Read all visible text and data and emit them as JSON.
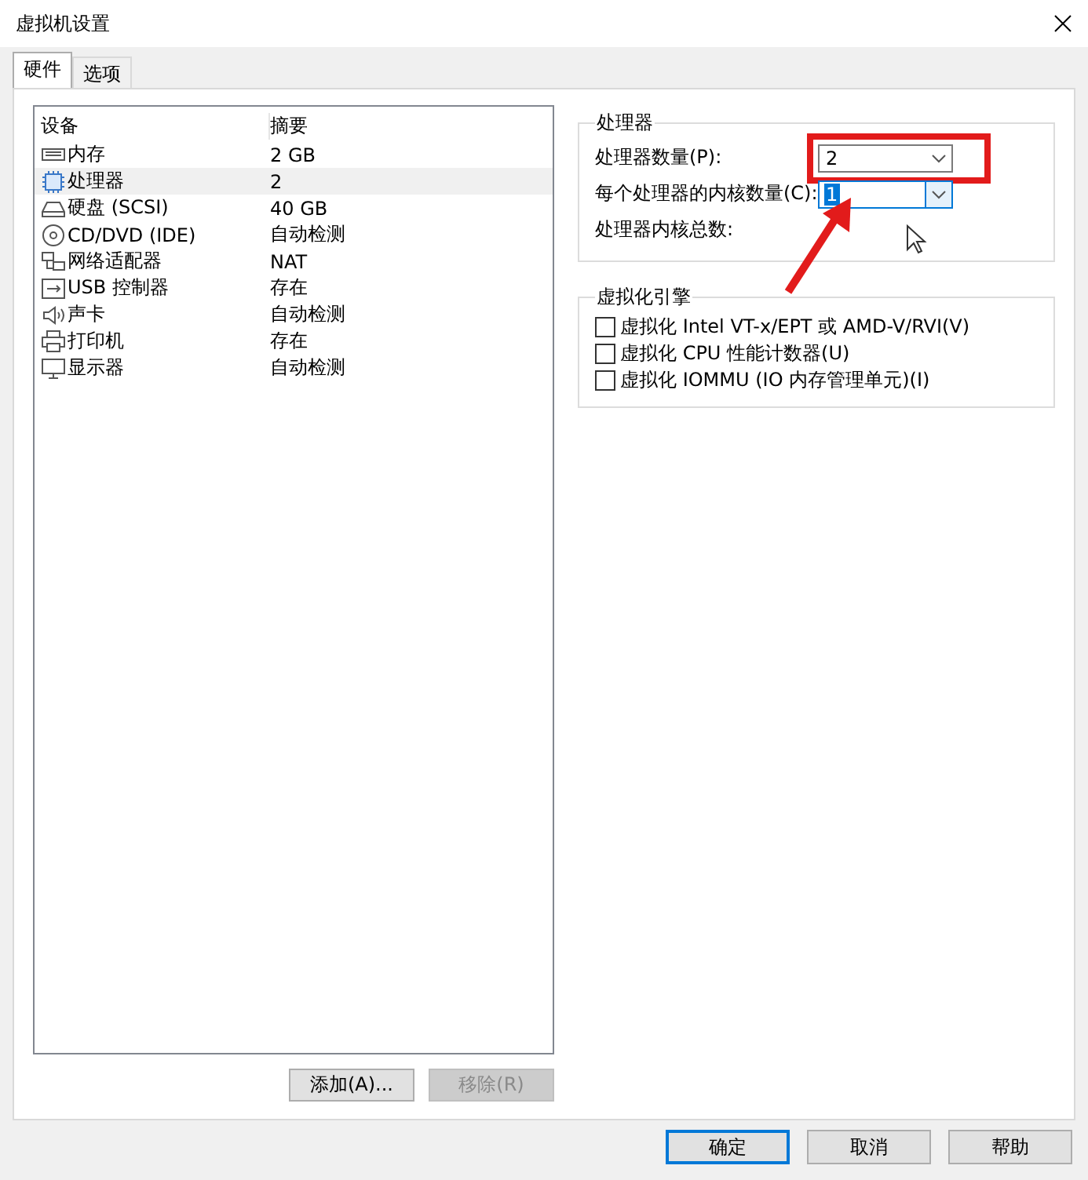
{
  "window": {
    "title": "虚拟机设置"
  },
  "tabs": [
    {
      "label": "硬件",
      "selected": true
    },
    {
      "label": "选项",
      "selected": false
    }
  ],
  "device_list": {
    "columns": [
      "设备",
      "摘要"
    ],
    "rows": [
      {
        "kind": "memory",
        "device": "内存",
        "summary": "2 GB",
        "selected": false
      },
      {
        "kind": "cpu",
        "device": "处理器",
        "summary": "2",
        "selected": true
      },
      {
        "kind": "disk",
        "device": "硬盘 (SCSI)",
        "summary": "40 GB",
        "selected": false
      },
      {
        "kind": "cdrom",
        "device": "CD/DVD (IDE)",
        "summary": "自动检测",
        "selected": false
      },
      {
        "kind": "network",
        "device": "网络适配器",
        "summary": "NAT",
        "selected": false
      },
      {
        "kind": "usb",
        "device": "USB 控制器",
        "summary": "存在",
        "selected": false
      },
      {
        "kind": "sound",
        "device": "声卡",
        "summary": "自动检测",
        "selected": false
      },
      {
        "kind": "printer",
        "device": "打印机",
        "summary": "存在",
        "selected": false
      },
      {
        "kind": "display",
        "device": "显示器",
        "summary": "自动检测",
        "selected": false
      }
    ]
  },
  "list_buttons": [
    {
      "label": "添加(A)...",
      "disabled": false
    },
    {
      "label": "移除(R)",
      "disabled": true
    }
  ],
  "processor_group": {
    "title": "处理器",
    "fields": [
      {
        "kind": "dropdown",
        "label": "处理器数量(P):",
        "value": "2",
        "focused": false,
        "highlighted": true
      },
      {
        "kind": "dropdown",
        "label": "每个处理器的内核数量(C):",
        "value": "1",
        "focused": true,
        "highlighted": false
      },
      {
        "kind": "text",
        "label": "处理器内核总数:"
      }
    ]
  },
  "virtualization_group": {
    "title": "虚拟化引擎",
    "options": [
      {
        "label": "虚拟化 Intel VT-x/EPT 或 AMD-V/RVI(V)",
        "checked": false
      },
      {
        "label": "虚拟化 CPU 性能计数器(U)",
        "checked": false
      },
      {
        "label": "虚拟化 IOMMU (IO 内存管理单元)(I)",
        "checked": false
      }
    ]
  },
  "dialog_buttons": [
    {
      "label": "确定",
      "default": true
    },
    {
      "label": "取消",
      "default": false
    },
    {
      "label": "帮助",
      "default": false
    }
  ]
}
